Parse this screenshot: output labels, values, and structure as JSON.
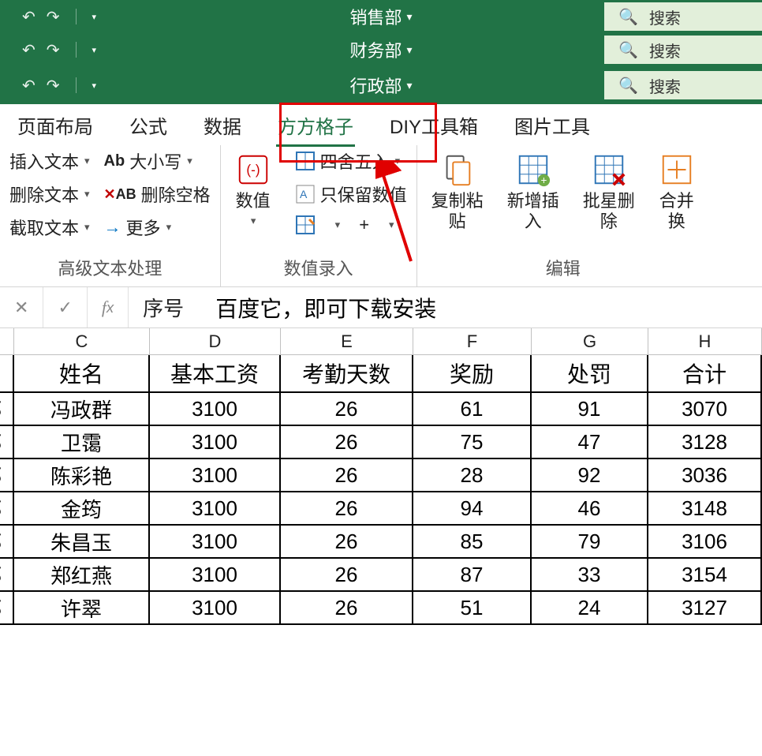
{
  "titlebars": [
    {
      "title": "销售部",
      "search": "搜索"
    },
    {
      "title": "财务部",
      "search": "搜索"
    },
    {
      "title": "行政部",
      "search": "搜索"
    }
  ],
  "ribbon_tabs": {
    "items": [
      "页面布局",
      "公式",
      "数据",
      "方方格子",
      "DIY工具箱",
      "图片工具"
    ],
    "active": "方方格子"
  },
  "ribbon": {
    "group1": {
      "label": "高级文本处理",
      "insert_text": "插入文本",
      "delete_text": "删除文本",
      "extract_text": "截取文本",
      "case": "大小写",
      "delete_space": "删除空格",
      "more": "更多"
    },
    "group2": {
      "label": "数值录入",
      "numeric": "数值",
      "round": "四舍五入",
      "keep_value": "只保留数值"
    },
    "group3": {
      "label": "编辑",
      "copy_paste": "复制粘\n贴",
      "new_insert": "新增插\n入",
      "batch_delete": "批星删\n除",
      "merge": "合并\n换"
    }
  },
  "formula_bar": {
    "cell_value": "序号",
    "annotation": "百度它，即可下载安装"
  },
  "chart_data": {
    "type": "table",
    "columns": [
      "C",
      "D",
      "E",
      "F",
      "G",
      "H"
    ],
    "headers": [
      "姓名",
      "基本工资",
      "考勤天数",
      "奖励",
      "处罚",
      "合计"
    ],
    "row_stub": "阝",
    "rows": [
      [
        "冯政群",
        3100,
        26,
        61,
        91,
        3070
      ],
      [
        "卫霭",
        3100,
        26,
        75,
        47,
        3128
      ],
      [
        "陈彩艳",
        3100,
        26,
        28,
        92,
        3036
      ],
      [
        "金筠",
        3100,
        26,
        94,
        46,
        3148
      ],
      [
        "朱昌玉",
        3100,
        26,
        85,
        79,
        3106
      ],
      [
        "郑红燕",
        3100,
        26,
        87,
        33,
        3154
      ],
      [
        "许翠",
        3100,
        26,
        51,
        24,
        3127
      ]
    ]
  }
}
